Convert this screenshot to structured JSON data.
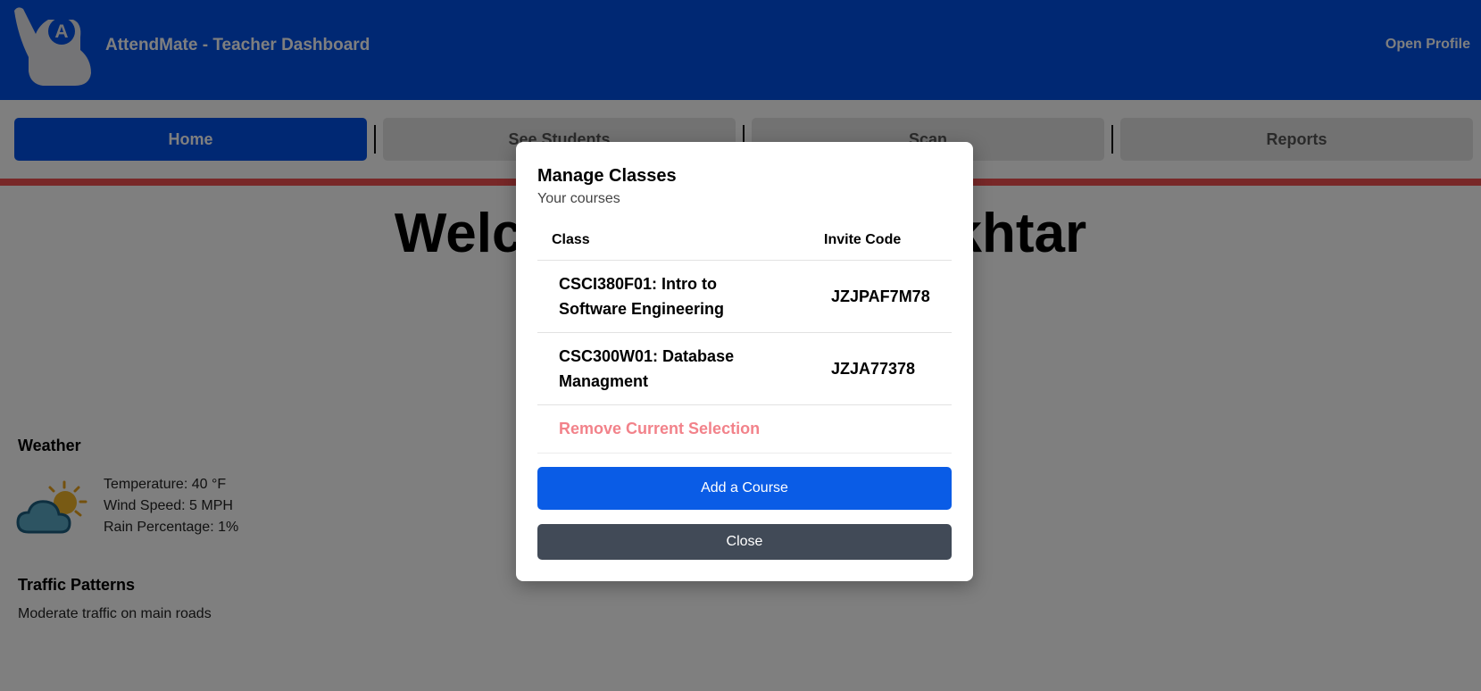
{
  "header": {
    "app_title": "AttendMate - Teacher Dashboard",
    "profile_link": "Open Profile",
    "logo_icon": "raised-hand-logo-icon",
    "logo_letter": "A"
  },
  "nav": {
    "tabs": [
      {
        "label": "Home",
        "active": true
      },
      {
        "label": "See Students",
        "active": false
      },
      {
        "label": "Scan",
        "active": false
      },
      {
        "label": "Reports",
        "active": false
      }
    ]
  },
  "main": {
    "welcome_left": "Welc",
    "welcome_right": "khtar",
    "weather": {
      "title": "Weather",
      "icon": "partly-cloudy-icon",
      "temperature": "Temperature: 40 °F",
      "wind_speed": "Wind Speed: 5 MPH",
      "rain": "Rain Percentage: 1%"
    },
    "traffic": {
      "title": "Traffic Patterns",
      "text": "Moderate traffic on main roads"
    }
  },
  "modal": {
    "title": "Manage Classes",
    "subtitle": "Your courses",
    "columns": {
      "class": "Class",
      "invite_code": "Invite Code"
    },
    "courses": [
      {
        "line1": "CSCI380F01: Intro to",
        "line2": "Software Engineering",
        "invite_code": "JZJPAF7M78"
      },
      {
        "line1": "CSC300W01: Database",
        "line2": "Managment",
        "invite_code": "JZJA77378"
      }
    ],
    "remove_label": "Remove Current Selection",
    "add_button": "Add a Course",
    "close_button": "Close"
  },
  "colors": {
    "header_blue": "#0050e6",
    "primary_button": "#0a5ce6",
    "secondary_button": "#414a57",
    "red_rule": "#f05050",
    "remove_text": "#f2828a"
  }
}
